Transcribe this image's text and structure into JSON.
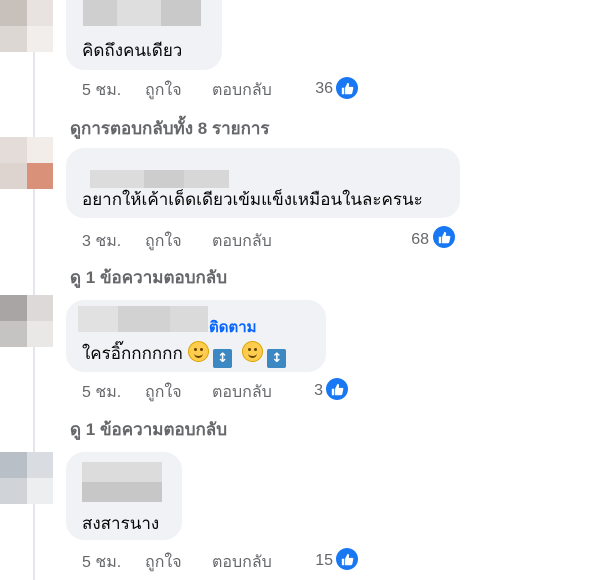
{
  "comments": [
    {
      "text": "คิดถึงคนเดียว",
      "time": "5 ชม.",
      "like": "ถูกใจ",
      "reply": "ตอบกลับ",
      "reactions": "36"
    },
    {
      "text": "อยากให้เค้าเด็ดเดียวเข้มแข็งเหมือนในละครนะ",
      "time": "3 ชม.",
      "like": "ถูกใจ",
      "reply": "ตอบกลับ",
      "reactions": "68"
    },
    {
      "follow": "ติดตาม",
      "text": "ใครอิ๊กกกกกก",
      "time": "5 ชม.",
      "like": "ถูกใจ",
      "reply": "ตอบกลับ",
      "reactions": "3"
    },
    {
      "text": "สงสารนาง",
      "time": "5 ชม.",
      "like": "ถูกใจ",
      "reply": "ตอบกลับ",
      "reactions": "15"
    }
  ],
  "view_replies": [
    "ดูการตอบกลับทั้ง 8 รายการ",
    "ดู 1 ข้อความตอบกลับ",
    "ดู 1 ข้อความตอบกลับ"
  ],
  "icons": {
    "like": "thumbs-up-icon",
    "emoji": "slightly-smiling-face-icon",
    "arrow": "up-down-arrow-icon"
  },
  "colors": {
    "bubble": "#f0f2f5",
    "secondary_text": "#65676b",
    "like_blue": "#1877f2",
    "follow_blue": "#0866ff"
  }
}
